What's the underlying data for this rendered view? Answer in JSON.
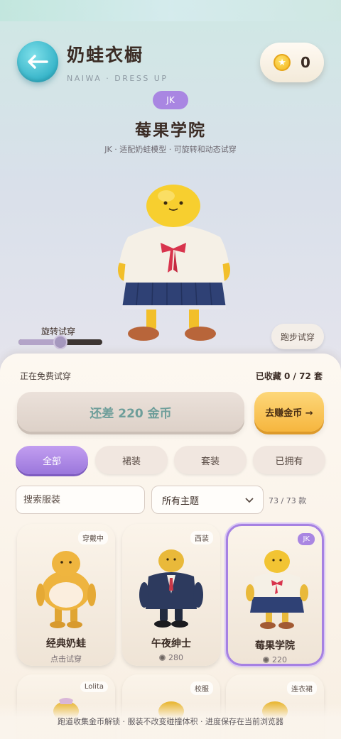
{
  "header": {
    "title": "奶蛙衣橱",
    "subtitle": "NAIWA · DRESS UP",
    "coin_count": "0"
  },
  "outfit": {
    "category": "JK",
    "name": "莓果学院",
    "description": "JK · 适配奶蛙模型 · 可旋转和动态试穿"
  },
  "controls": {
    "rotate_label": "旋转试穿",
    "rotate_value": 0.5,
    "run_label": "跑步试穿"
  },
  "panel": {
    "trying_label": "正在免费试穿",
    "collected_label": "已收藏 0 / 72 套",
    "buy_label": "还差 220 金币",
    "earn_label": "去赚金币 →"
  },
  "tabs": [
    "全部",
    "裙装",
    "套装",
    "已拥有"
  ],
  "filters": {
    "search_placeholder": "搜索服装",
    "theme_value": "所有主题",
    "count": "73 / 73 款"
  },
  "cards": [
    {
      "tag": "穿戴中",
      "name": "经典奶蛙",
      "sub": "点击试穿"
    },
    {
      "tag": "西装",
      "name": "午夜绅士",
      "price": "280"
    },
    {
      "tag": "JK",
      "name": "莓果学院",
      "price": "220"
    }
  ],
  "cards_row2": [
    {
      "tag": "Lolita"
    },
    {
      "tag": "校服"
    },
    {
      "tag": "连衣裙"
    }
  ],
  "footer": {
    "note": "跑道收集金币解锁 · 服装不改变碰撞体积 · 进度保存在当前浏览器"
  },
  "colors": {
    "accent": "#a986e2",
    "earn": "#f6b63e",
    "back": "#35b3c8"
  }
}
